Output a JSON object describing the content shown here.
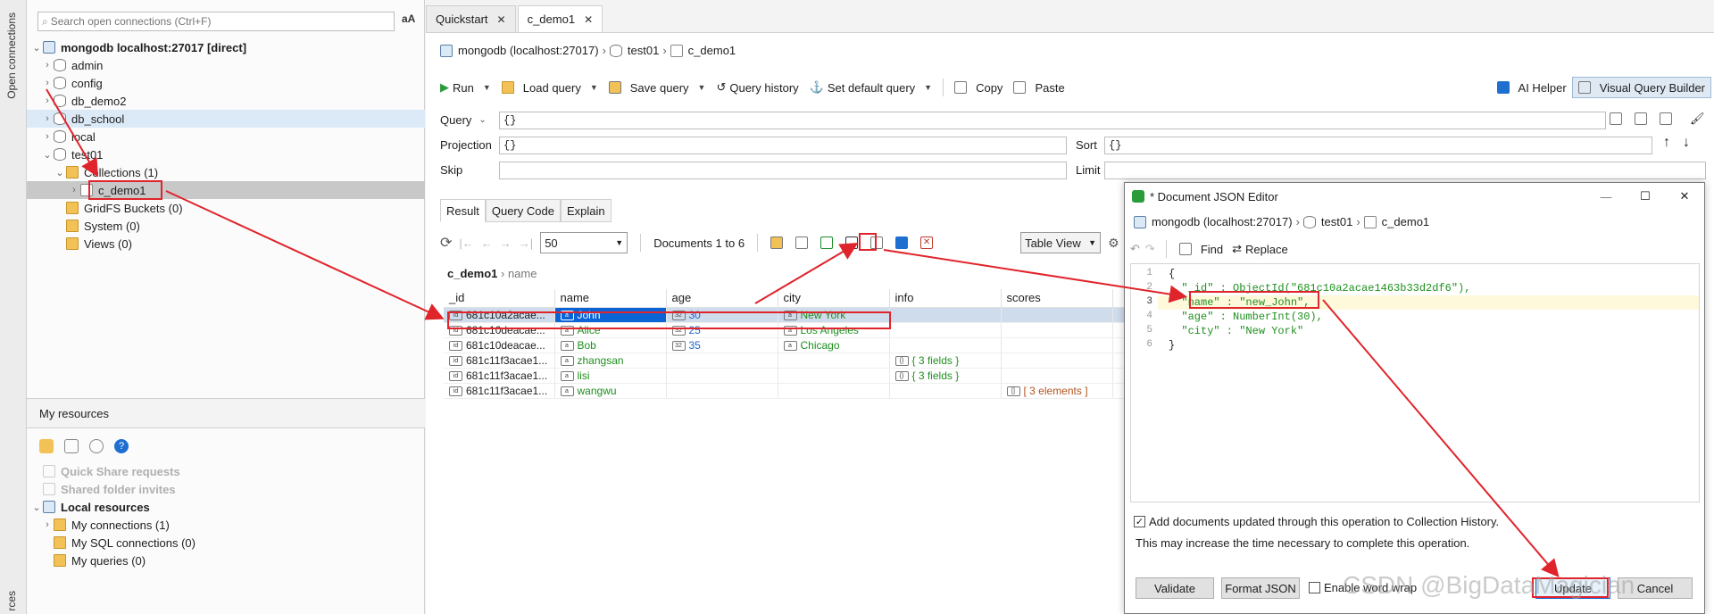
{
  "strip": {
    "open_connections": "Open connections",
    "resources": "rces"
  },
  "sidebar": {
    "search_placeholder": "Search open connections (Ctrl+F)",
    "case_toggle": "aA",
    "tree": [
      {
        "label": "mongodb localhost:27017 [direct]",
        "icon": "server-icon"
      },
      {
        "label": "admin",
        "icon": "database-icon"
      },
      {
        "label": "config",
        "icon": "database-icon"
      },
      {
        "label": "db_demo2",
        "icon": "database-icon"
      },
      {
        "label": "db_school",
        "icon": "database-icon"
      },
      {
        "label": "local",
        "icon": "database-icon"
      },
      {
        "label": "test01",
        "icon": "database-icon"
      },
      {
        "label": "Collections (1)",
        "icon": "folder-icon"
      },
      {
        "label": "c_demo1",
        "icon": "collection-icon"
      },
      {
        "label": "GridFS Buckets (0)",
        "icon": "folder-icon"
      },
      {
        "label": "System (0)",
        "icon": "folder-icon"
      },
      {
        "label": "Views (0)",
        "icon": "folder-icon"
      }
    ],
    "resources_title": "My resources",
    "resources": {
      "quick_share": "Quick Share requests",
      "shared_invites": "Shared folder invites",
      "local_resources": "Local resources",
      "my_connections": "My connections (1)",
      "my_sql": "My SQL connections (0)",
      "my_queries": "My queries (0)"
    }
  },
  "tabs": [
    {
      "label": "Quickstart"
    },
    {
      "label": "c_demo1"
    }
  ],
  "crumb": {
    "conn": "mongodb (localhost:27017)",
    "db": "test01",
    "coll": "c_demo1"
  },
  "toolbar": {
    "run": "Run",
    "load_query": "Load query",
    "save_query": "Save query",
    "history": "Query history",
    "set_default": "Set default query",
    "copy": "Copy",
    "paste": "Paste",
    "ai": "AI Helper",
    "vqb": "Visual Query Builder"
  },
  "query": {
    "query_label": "Query",
    "query_value": "{}",
    "projection_label": "Projection",
    "projection_value": "{}",
    "sort_label": "Sort",
    "sort_value": "{}",
    "skip_label": "Skip",
    "skip_value": "",
    "limit_label": "Limit",
    "limit_value": ""
  },
  "result_tabs": [
    {
      "label": "Result"
    },
    {
      "label": "Query Code"
    },
    {
      "label": "Explain"
    }
  ],
  "grid": {
    "page_size": "50",
    "docs_label": "Documents 1 to 6",
    "view": "Table View",
    "crumb_coll": "c_demo1",
    "crumb_field": "name",
    "columns": [
      "_id",
      "name",
      "age",
      "city",
      "info",
      "scores"
    ],
    "rows": [
      {
        "id": "681c10a2acae...",
        "name": "John",
        "age": "30",
        "city": "New York",
        "info": "",
        "scores": ""
      },
      {
        "id": "681c10deacae...",
        "name": "Alice",
        "age": "25",
        "city": "Los Angeles",
        "info": "",
        "scores": ""
      },
      {
        "id": "681c10deacae...",
        "name": "Bob",
        "age": "35",
        "city": "Chicago",
        "info": "",
        "scores": ""
      },
      {
        "id": "681c11f3acae1...",
        "name": "zhangsan",
        "age": "",
        "city": "",
        "info": "{ 3 fields }",
        "scores": ""
      },
      {
        "id": "681c11f3acae1...",
        "name": "lisi",
        "age": "",
        "city": "",
        "info": "{ 3 fields }",
        "scores": ""
      },
      {
        "id": "681c11f3acae1...",
        "name": "wangwu",
        "age": "",
        "city": "",
        "info": "",
        "scores": "[ 3 elements ]"
      }
    ]
  },
  "dialog": {
    "title": "* Document JSON Editor",
    "crumb": {
      "conn": "mongodb (localhost:27017)",
      "db": "test01",
      "coll": "c_demo1"
    },
    "find": "Find",
    "replace": "Replace",
    "lines": [
      {
        "n": "1",
        "text": "{"
      },
      {
        "n": "2",
        "text": "  \"_id\" : ObjectId(\"681c10a2acae1463b33d2df6\"),"
      },
      {
        "n": "3",
        "text": "  \"name\" : \"new_John\","
      },
      {
        "n": "4",
        "text": "  \"age\" : NumberInt(30),"
      },
      {
        "n": "5",
        "text": "  \"city\" : \"New York\""
      },
      {
        "n": "6",
        "text": "}"
      }
    ],
    "history_label": "Add documents updated through this operation to Collection History.",
    "history_note": "This may increase the time necessary to complete this operation.",
    "validate": "Validate",
    "format": "Format JSON",
    "wrap": "Enable word wrap",
    "update": "Update",
    "cancel": "Cancel"
  },
  "watermark": "CSDN @BigDataMagician",
  "colors": {
    "annotation": "#e0242b",
    "selection": "#0a64d6",
    "string": "#1f8f1f",
    "number": "#2266cc"
  }
}
